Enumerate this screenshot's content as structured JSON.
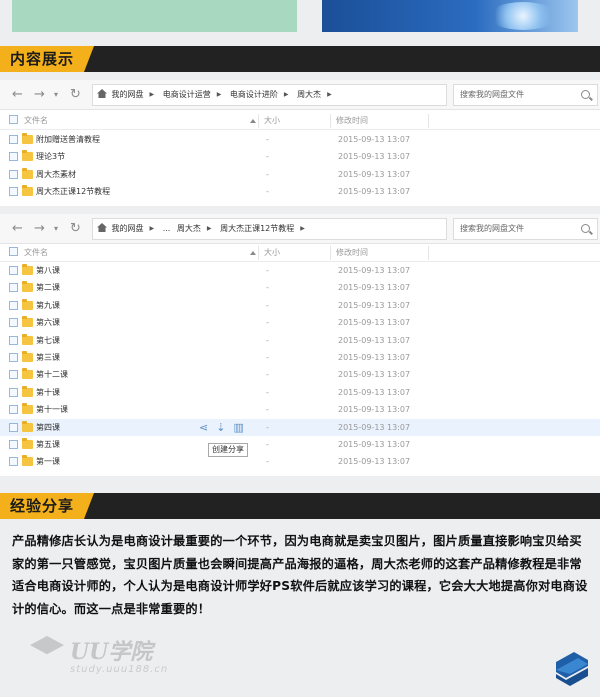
{
  "sections": {
    "content_title": "内容展示",
    "experience_title": "经验分享"
  },
  "explorer1": {
    "path": [
      "我的网盘",
      "电商设计运营",
      "电商设计进阶",
      "周大杰"
    ],
    "search_placeholder": "搜索我的网盘文件",
    "columns": {
      "name": "文件名",
      "size": "大小",
      "modified": "修改时间"
    },
    "rows": [
      {
        "name": "附加赠送普清教程",
        "size": "-",
        "time": "2015-09-13 13:07"
      },
      {
        "name": "理论3节",
        "size": "-",
        "time": "2015-09-13 13:07"
      },
      {
        "name": "周大杰素材",
        "size": "-",
        "time": "2015-09-13 13:07"
      },
      {
        "name": "周大杰正课12节教程",
        "size": "-",
        "time": "2015-09-13 13:07"
      }
    ]
  },
  "explorer2": {
    "path": [
      "我的网盘",
      "...",
      "周大杰",
      "周大杰正课12节教程"
    ],
    "search_placeholder": "搜索我的网盘文件",
    "columns": {
      "name": "文件名",
      "size": "大小",
      "modified": "修改时间"
    },
    "rows": [
      {
        "name": "第八课",
        "size": "-",
        "time": "2015-09-13 13:07"
      },
      {
        "name": "第二课",
        "size": "-",
        "time": "2015-09-13 13:07"
      },
      {
        "name": "第九课",
        "size": "-",
        "time": "2015-09-13 13:07"
      },
      {
        "name": "第六课",
        "size": "-",
        "time": "2015-09-13 13:07"
      },
      {
        "name": "第七课",
        "size": "-",
        "time": "2015-09-13 13:07"
      },
      {
        "name": "第三课",
        "size": "-",
        "time": "2015-09-13 13:07"
      },
      {
        "name": "第十二课",
        "size": "-",
        "time": "2015-09-13 13:07"
      },
      {
        "name": "第十课",
        "size": "-",
        "time": "2015-09-13 13:07"
      },
      {
        "name": "第十一课",
        "size": "-",
        "time": "2015-09-13 13:07"
      },
      {
        "name": "第四课",
        "size": "-",
        "time": "2015-09-13 13:07"
      },
      {
        "name": "第五课",
        "size": "-",
        "time": "2015-09-13 13:07"
      },
      {
        "name": "第一课",
        "size": "-",
        "time": "2015-09-13 13:07"
      }
    ],
    "tooltip": "创建分享"
  },
  "description": "产品精修店长认为是电商设计最重要的一个环节，因为电商就是卖宝贝图片，图片质量直接影响宝贝给买家的第一只管感觉，宝贝图片质量也会瞬间提高产品海报的逼格，周大杰老师的这套产品精修教程是非常适合电商设计师的，个人认为是电商设计师学好PS软件后就应该学习的课程，它会大大地提高你对电商设计的信心。而这一点是非常重要的！",
  "watermark": {
    "name": "UU学院",
    "url": "study.uuu188.cn"
  },
  "colors": {
    "tag": "#f3b01a",
    "bar": "#222222",
    "accent": "#5f8fc4"
  }
}
